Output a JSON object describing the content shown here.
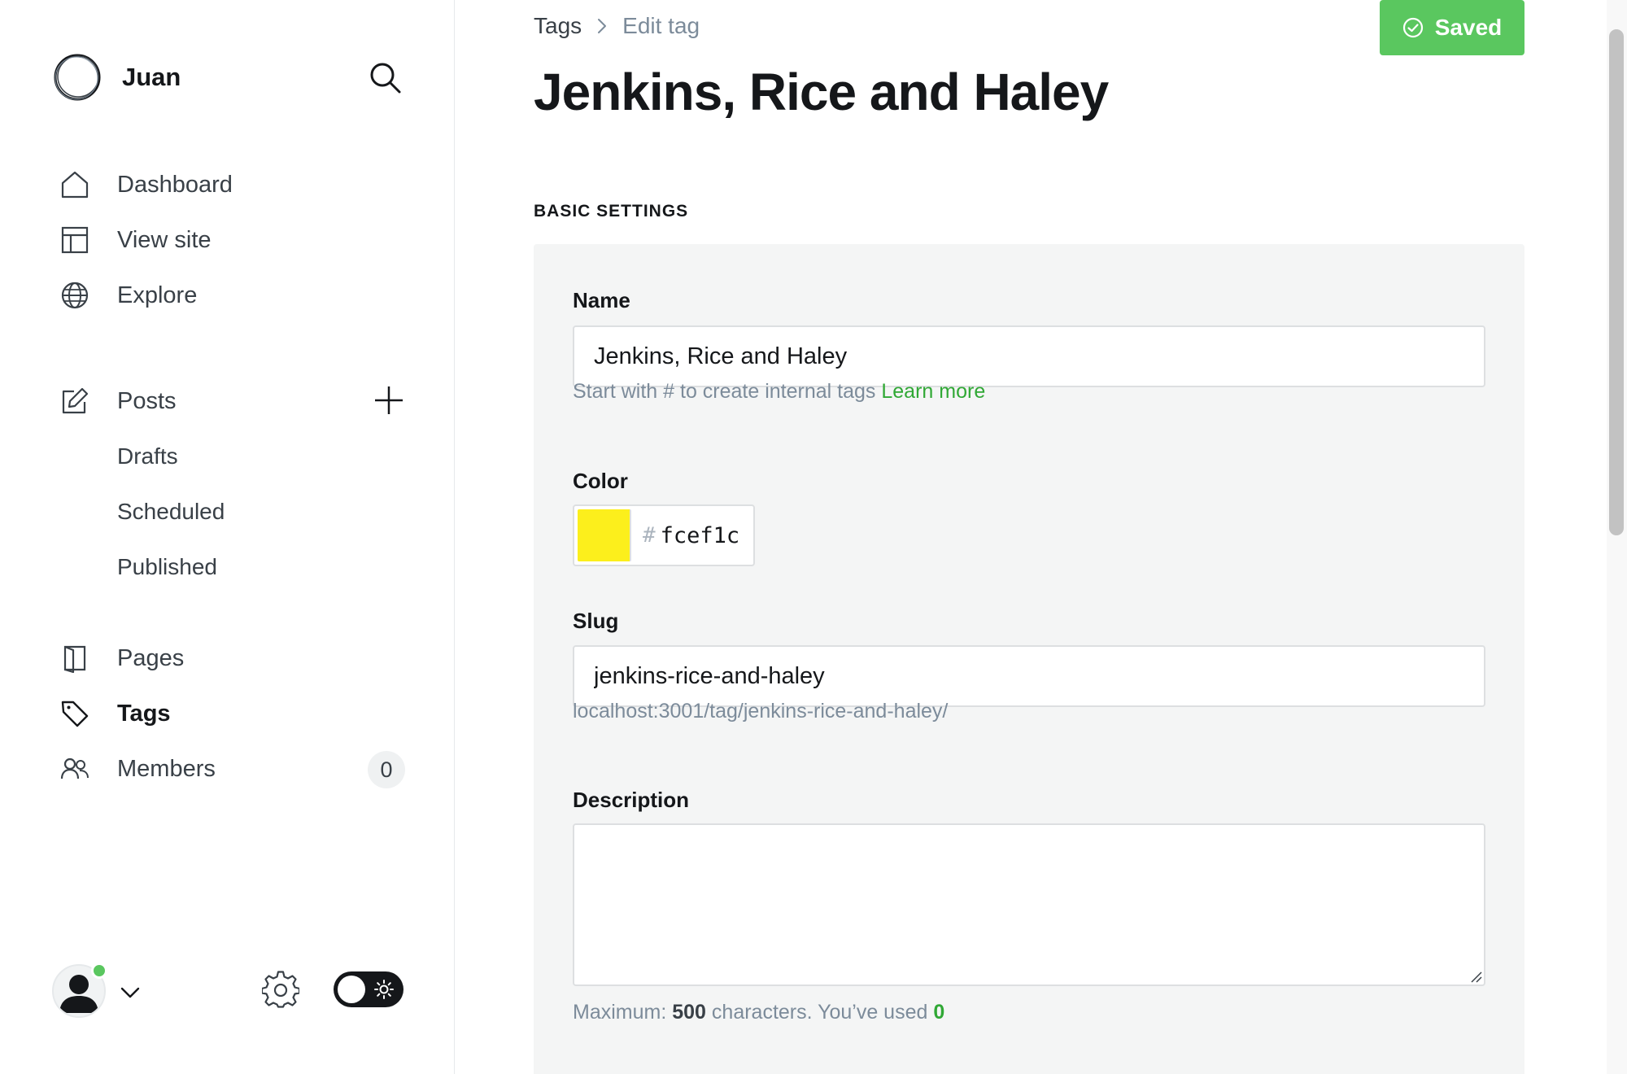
{
  "sidebar": {
    "brand": {
      "name": "Juan"
    },
    "nav": {
      "dashboard": "Dashboard",
      "view_site": "View site",
      "explore": "Explore",
      "posts": "Posts",
      "drafts": "Drafts",
      "scheduled": "Scheduled",
      "published": "Published",
      "pages": "Pages",
      "tags": "Tags",
      "members": "Members",
      "members_count": "0"
    },
    "active_item": "tags"
  },
  "header": {
    "breadcrumb": {
      "root": "Tags",
      "current": "Edit tag"
    },
    "saved_label": "Saved",
    "title": "Jenkins, Rice and Haley"
  },
  "form": {
    "section_title": "BASIC SETTINGS",
    "name": {
      "label": "Name",
      "value": "Jenkins, Rice and Haley",
      "hint": "Start with # to create internal tags",
      "hint_link": "Learn more"
    },
    "color": {
      "label": "Color",
      "hash": "#",
      "value": "fcef1c",
      "swatch_color": "#fcef1c"
    },
    "slug": {
      "label": "Slug",
      "value": "jenkins-rice-and-haley",
      "url_preview": "localhost:3001/tag/jenkins-rice-and-haley/"
    },
    "description": {
      "label": "Description",
      "value": "",
      "hint_prefix": "Maximum:",
      "max": "500",
      "hint_mid": "characters. You’ve used",
      "used": "0"
    }
  },
  "colors": {
    "accent_green": "#5ac75f",
    "link_green": "#30a835",
    "panel_bg": "#f4f5f5"
  }
}
